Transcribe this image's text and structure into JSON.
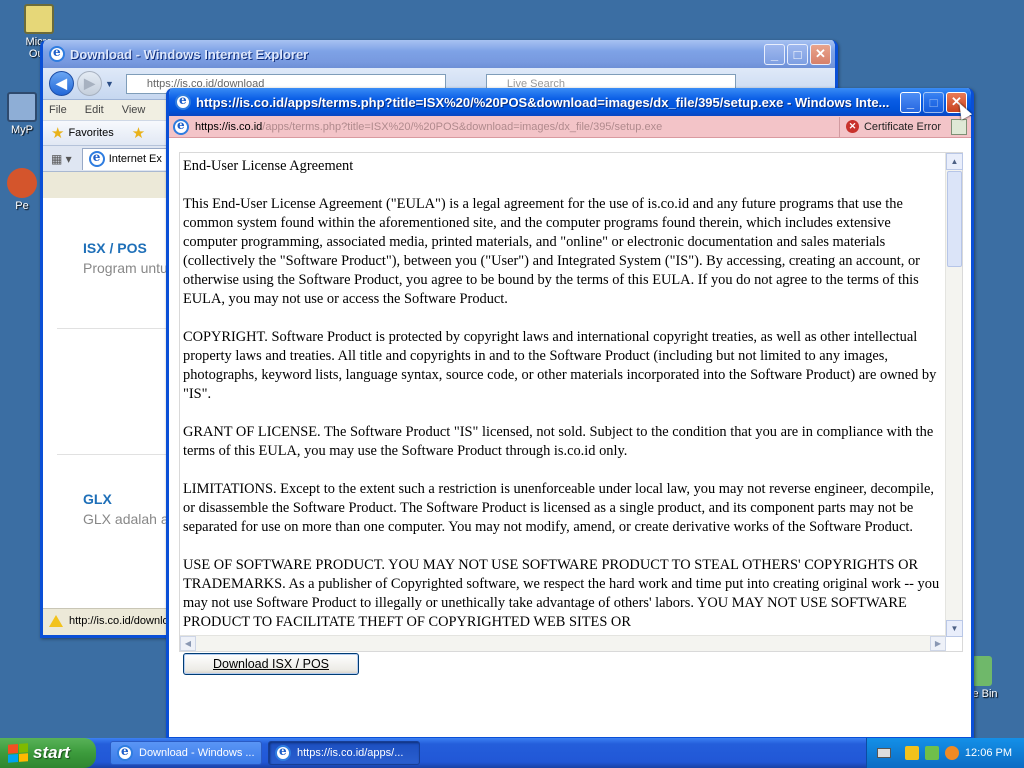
{
  "desktop": {
    "icons": [
      {
        "label": "Micro Outl"
      },
      {
        "label": "MyP"
      },
      {
        "label": "Pe"
      },
      {
        "label": "le Bin"
      }
    ]
  },
  "back_window": {
    "title": "Download - Windows Internet Explorer",
    "address": "https://is.co.id/download",
    "search_placeholder": "Live Search",
    "menu": [
      "File",
      "Edit",
      "View"
    ],
    "favorites_label": "Favorites",
    "tab_label": "Internet Ex",
    "products": [
      {
        "name": "ISX / POS",
        "desc": "Program untu"
      },
      {
        "name": "GLX",
        "desc": "GLX adalah ap"
      }
    ],
    "status_text": "http://is.co.id/downlo"
  },
  "popup": {
    "title": "https://is.co.id/apps/terms.php?title=ISX%20/%20POS&download=images/dx_file/395/setup.exe - Windows Inte...",
    "address_host": "https://is.co.id",
    "address_rest": "/apps/terms.php?title=ISX%20/%20POS&download=images/dx_file/395/setup.exe",
    "certificate_label": "Certificate Error",
    "eula_paragraphs": [
      "End-User License Agreement",
      "This End-User License Agreement (\"EULA\") is a legal agreement for the use of is.co.id and any future programs that use the common system found within the aforementioned site, and the computer programs found therein, which includes extensive computer programming, associated media, printed materials, and \"online\" or electronic documentation and sales materials (collectively the \"Software Product\"), between you (\"User\") and Integrated System (\"IS\"). By accessing, creating an account, or otherwise using the Software Product, you agree to be bound by the terms of this EULA. If you do not agree to the terms of this EULA, you may not use or access the Software Product.",
      "COPYRIGHT. Software Product is protected by copyright laws and international copyright treaties, as well as other intellectual property laws and treaties. All title and copyrights in and to the Software Product (including but not limited to any images, photographs, keyword lists, language syntax, source code, or other materials incorporated into the Software Product) are owned by \"IS\".",
      "GRANT OF LICENSE. The Software Product \"IS\" licensed, not sold. Subject to the condition that you are in compliance with the terms of this EULA, you may use the Software Product through is.co.id only.",
      "LIMITATIONS. Except to the extent such a restriction is unenforceable under local law, you may not reverse engineer, decompile, or disassemble the Software Product. The Software Product is licensed as a single product, and its component parts may not be separated for use on more than one computer. You may not modify, amend, or create derivative works of the Software Product.",
      "USE OF SOFTWARE PRODUCT. YOU MAY NOT USE SOFTWARE PRODUCT TO STEAL OTHERS' COPYRIGHTS OR TRADEMARKS. As a publisher of Copyrighted software, we respect the hard work and time put into creating original work -- you may not use Software Product to illegally or unethically take advantage of others' labors. YOU MAY NOT USE SOFTWARE PRODUCT TO FACILITATE THEFT OF COPYRIGHTED WEB SITES OR"
    ],
    "download_button": "Download ISX / POS"
  },
  "taskbar": {
    "start_label": "start",
    "tasks": [
      {
        "label": "Download - Windows ..."
      },
      {
        "label": "https://is.co.id/apps/..."
      }
    ],
    "clock": "12:06 PM"
  },
  "colors": {
    "xp_blue": "#0052d9",
    "cert_error_bg": "#f3c4c8",
    "link_blue": "#1e6fb8"
  }
}
